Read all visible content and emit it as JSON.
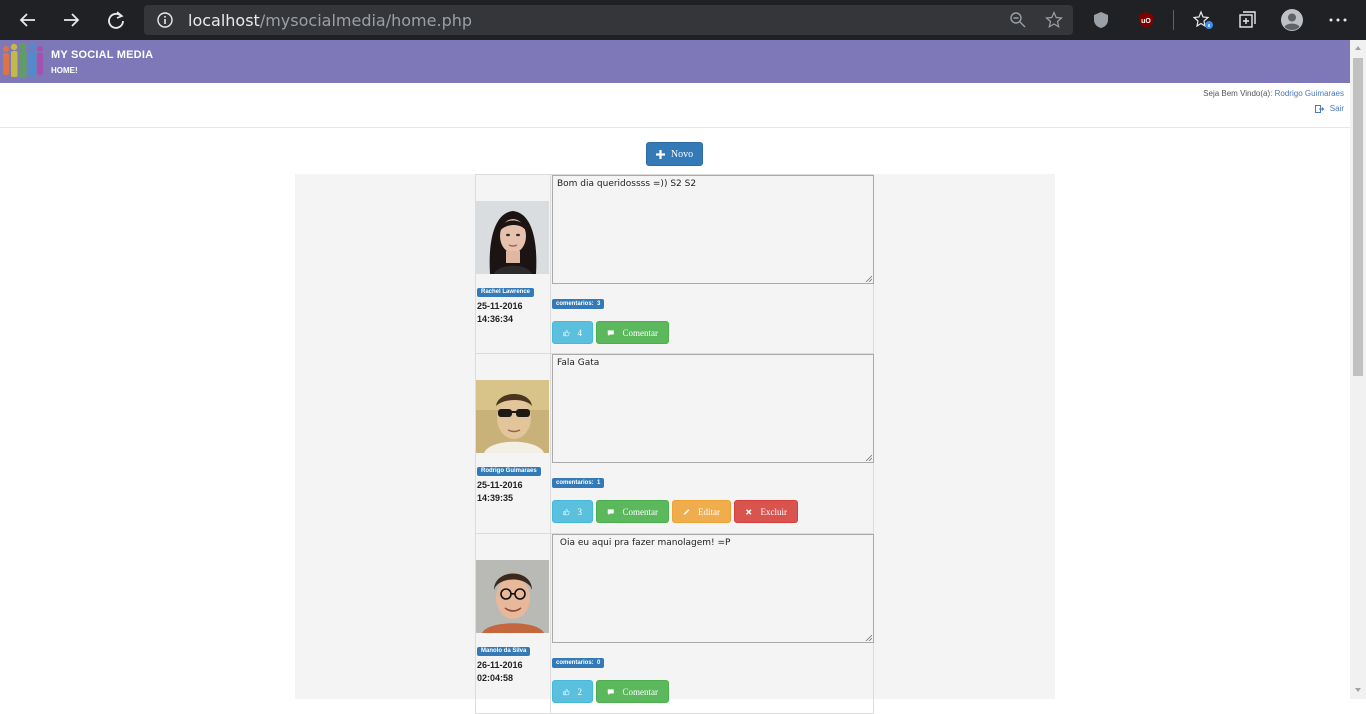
{
  "browser": {
    "url_host": "localhost",
    "url_path": "/mysocialmedia/home.php"
  },
  "header": {
    "title": "MY SOCIAL MEDIA",
    "subtitle": "HOME!"
  },
  "welcome": {
    "prefix": "Seja Bem Vindo(a):",
    "user": "Rodrigo Guimaraes",
    "logout": "Sair"
  },
  "new_button": "Novo",
  "posts": [
    {
      "author": "Rachel Lawrence",
      "date": "25-11-2016",
      "time": "14:36:34",
      "text": "Bom dia queridossss =)) S2 S2",
      "comments_label": "comentarios:",
      "comments_count": "3",
      "likes": "4",
      "comment_button": "Comentar"
    },
    {
      "author": "Rodrigo Guimaraes",
      "date": "25-11-2016",
      "time": "14:39:35",
      "text": "Fala Gata",
      "comments_label": "comentarios:",
      "comments_count": "1",
      "likes": "3",
      "comment_button": "Comentar",
      "edit_button": "Editar",
      "delete_button": "Excluir"
    },
    {
      "author": "Manolo da Silva",
      "date": "26-11-2016",
      "time": "02:04:58",
      "text": " Oia eu aqui pra fazer manolagem! =P",
      "comments_label": "comentarios:",
      "comments_count": "0",
      "likes": "2",
      "comment_button": "Comentar"
    }
  ]
}
